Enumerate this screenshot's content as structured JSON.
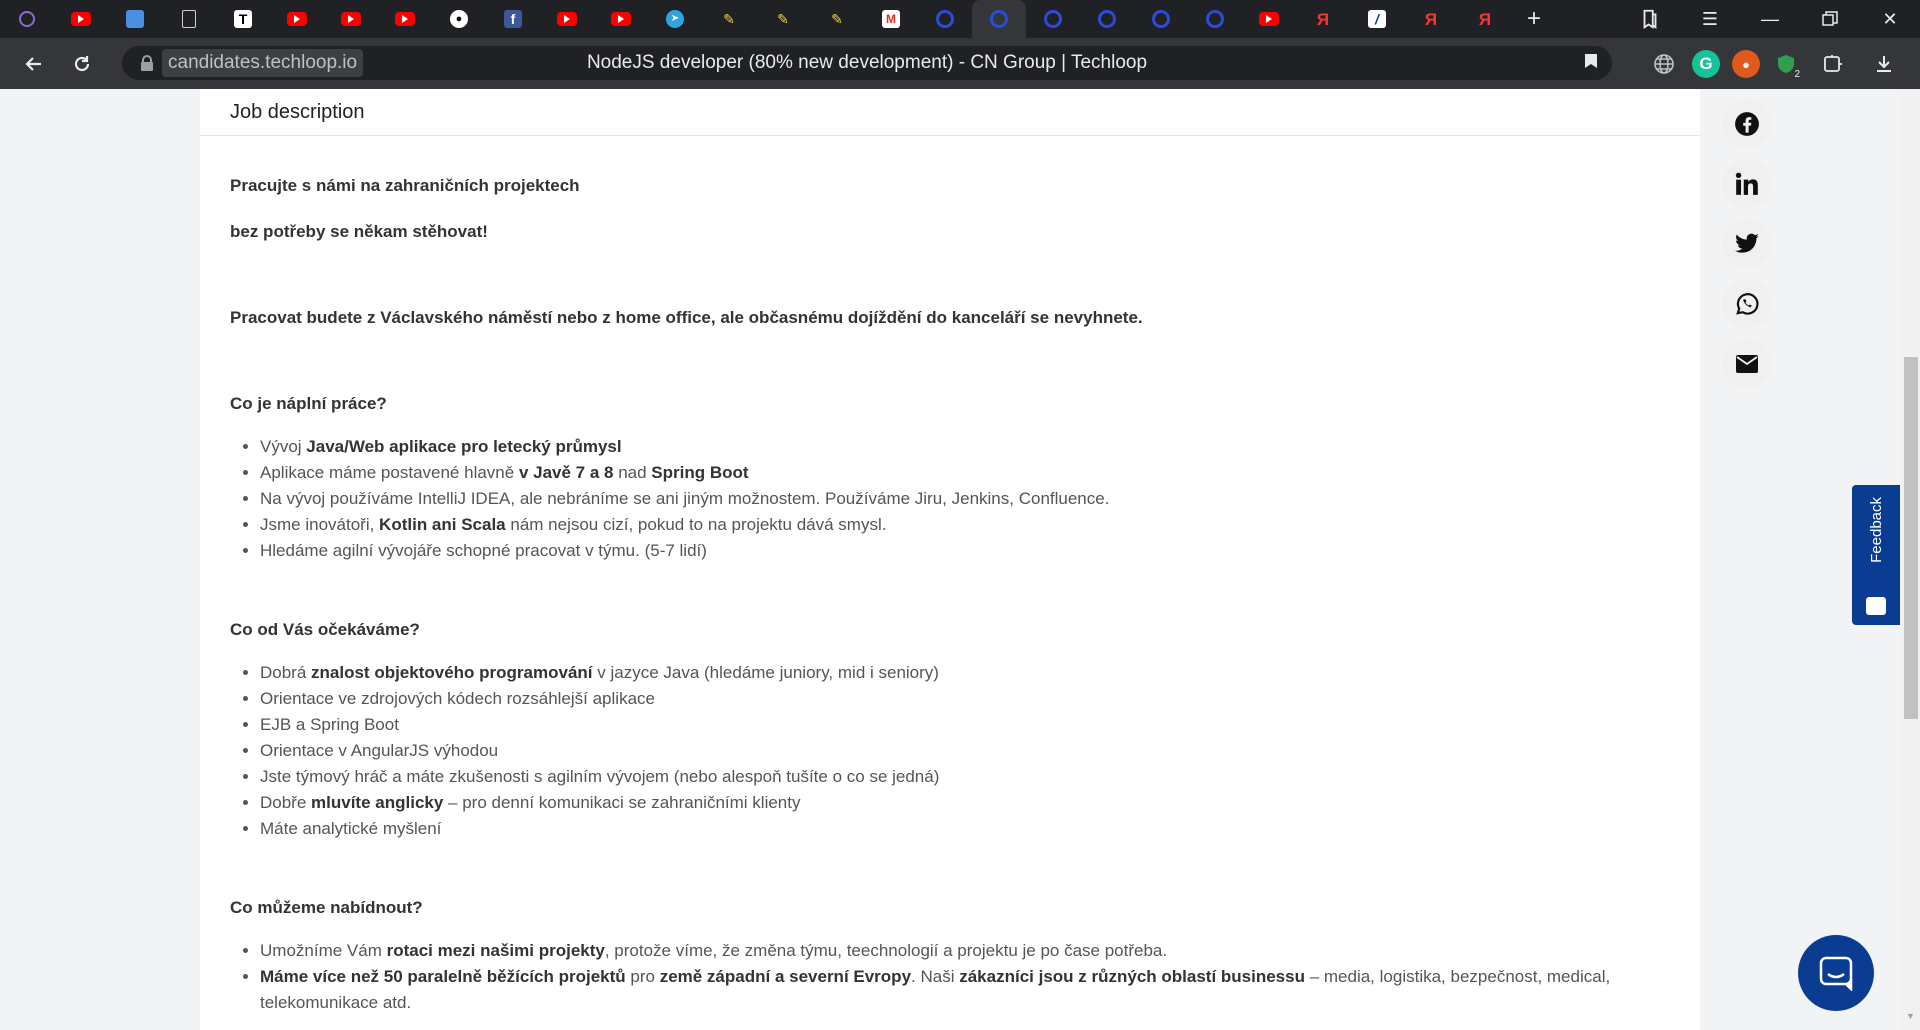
{
  "browser": {
    "tabs": [
      {
        "icon": "purple-circle-icon",
        "kind": "purple"
      },
      {
        "icon": "youtube-icon",
        "kind": "yt"
      },
      {
        "icon": "chat-icon",
        "kind": "chat"
      },
      {
        "icon": "document-icon",
        "kind": "doc"
      },
      {
        "icon": "t-icon",
        "kind": "t",
        "glyph": "T"
      },
      {
        "icon": "youtube-icon",
        "kind": "yt"
      },
      {
        "icon": "youtube-icon",
        "kind": "yt"
      },
      {
        "icon": "youtube-icon",
        "kind": "yt"
      },
      {
        "icon": "github-icon",
        "kind": "gh",
        "glyph": "●"
      },
      {
        "icon": "facebook-icon",
        "kind": "fb",
        "glyph": "f"
      },
      {
        "icon": "youtube-icon",
        "kind": "yt"
      },
      {
        "icon": "youtube-icon",
        "kind": "yt"
      },
      {
        "icon": "telegram-icon",
        "kind": "tg",
        "glyph": "➤"
      },
      {
        "icon": "pen-icon",
        "kind": "pen",
        "glyph": "✎"
      },
      {
        "icon": "pen-icon",
        "kind": "pen",
        "glyph": "✎"
      },
      {
        "icon": "pen-icon",
        "kind": "pen",
        "glyph": "✎"
      },
      {
        "icon": "gmail-icon",
        "kind": "gm",
        "glyph": "M"
      },
      {
        "icon": "ring-icon",
        "kind": "ring"
      },
      {
        "icon": "ring-icon",
        "kind": "ring",
        "active": true
      },
      {
        "icon": "ring-icon",
        "kind": "ring"
      },
      {
        "icon": "ring-icon",
        "kind": "ring"
      },
      {
        "icon": "ring-icon",
        "kind": "ring"
      },
      {
        "icon": "ring-icon",
        "kind": "ring"
      },
      {
        "icon": "youtube-icon",
        "kind": "yt"
      },
      {
        "icon": "yandex-icon",
        "kind": "ya",
        "glyph": "Я"
      },
      {
        "icon": "slash-icon",
        "kind": "slash",
        "glyph": "/"
      },
      {
        "icon": "yandex-icon",
        "kind": "ya",
        "glyph": "Я"
      },
      {
        "icon": "yandex-icon",
        "kind": "ya",
        "glyph": "Я"
      }
    ],
    "url": "candidates.techloop.io",
    "page_title": "NodeJS developer (80% new development) - CN Group | Techloop",
    "extension_badge": "2"
  },
  "job": {
    "section_title": "Job description",
    "intro_1": "Pracujte s námi na zahraničních projektech",
    "intro_2": "bez potřeby se někam stěhovat!",
    "intro_3": "Pracovat budete z Václavského náměstí nebo z home office, ale občasnému dojíždění do kanceláří se nevyhnete.",
    "duties": {
      "heading": "Co je náplní práce?",
      "items": [
        [
          {
            "t": "Vývoj "
          },
          {
            "t": "Java/Web aplikace pro letecký průmysl",
            "b": true
          }
        ],
        [
          {
            "t": "Aplikace máme postavené hlavně "
          },
          {
            "t": "v Javě 7 a 8",
            "b": true
          },
          {
            "t": " nad "
          },
          {
            "t": "Spring Boot",
            "b": true
          }
        ],
        [
          {
            "t": "Na vývoj používáme IntelliJ IDEA, ale nebráníme se ani jiným možnostem. Používáme Jiru, Jenkins, Confluence."
          }
        ],
        [
          {
            "t": "Jsme inovátoři, "
          },
          {
            "t": "Kotlin ani Scala",
            "b": true
          },
          {
            "t": " nám nejsou cizí, pokud to na projektu dává smysl."
          }
        ],
        [
          {
            "t": "Hledáme agilní vývojáře schopné pracovat v týmu. (5-7 lidí)"
          }
        ]
      ]
    },
    "expectations": {
      "heading": "Co od Vás očekáváme?",
      "items": [
        [
          {
            "t": "Dobrá "
          },
          {
            "t": "znalost objektového programování",
            "b": true
          },
          {
            "t": " v jazyce Java (hledáme juniory, mid i seniory)"
          }
        ],
        [
          {
            "t": "Orientace ve zdrojových kódech rozsáhlejší aplikace"
          }
        ],
        [
          {
            "t": "EJB a Spring Boot"
          }
        ],
        [
          {
            "t": "Orientace v AngularJS výhodou"
          }
        ],
        [
          {
            "t": "Jste týmový hráč a máte zkušenosti s agilním vývojem (nebo alespoň tušíte o co se jedná)"
          }
        ],
        [
          {
            "t": "Dobře "
          },
          {
            "t": "mluvíte anglicky",
            "b": true
          },
          {
            "t": " – pro denní komunikaci se zahraničními klienty"
          }
        ],
        [
          {
            "t": "Máte analytické myšlení"
          }
        ]
      ]
    },
    "offer": {
      "heading": "Co můžeme nabídnout?",
      "items": [
        [
          {
            "t": "Umožníme Vám "
          },
          {
            "t": "rotaci mezi našimi projekty",
            "b": true
          },
          {
            "t": ", protože víme, že změna týmu, teechnologií a projektu je po čase potřeba."
          }
        ],
        [
          {
            "t": "Máme více než 50 paralelně běžících projektů",
            "b": true
          },
          {
            "t": " pro "
          },
          {
            "t": "země západní a severní Evropy",
            "b": true
          },
          {
            "t": ". Naši "
          },
          {
            "t": "zákazníci jsou z různých oblastí businessu",
            "b": true
          },
          {
            "t": " – media, logistika, bezpečnost, medical, telekomunikace atd."
          }
        ]
      ]
    }
  },
  "share": [
    {
      "name": "facebook-share-icon"
    },
    {
      "name": "linkedin-share-icon"
    },
    {
      "name": "twitter-share-icon"
    },
    {
      "name": "whatsapp-share-icon"
    },
    {
      "name": "email-share-icon"
    }
  ],
  "feedback_label": "Feedback",
  "colors": {
    "brand": "#0a3d91",
    "chrome_dark": "#202124",
    "chrome": "#35363a"
  }
}
